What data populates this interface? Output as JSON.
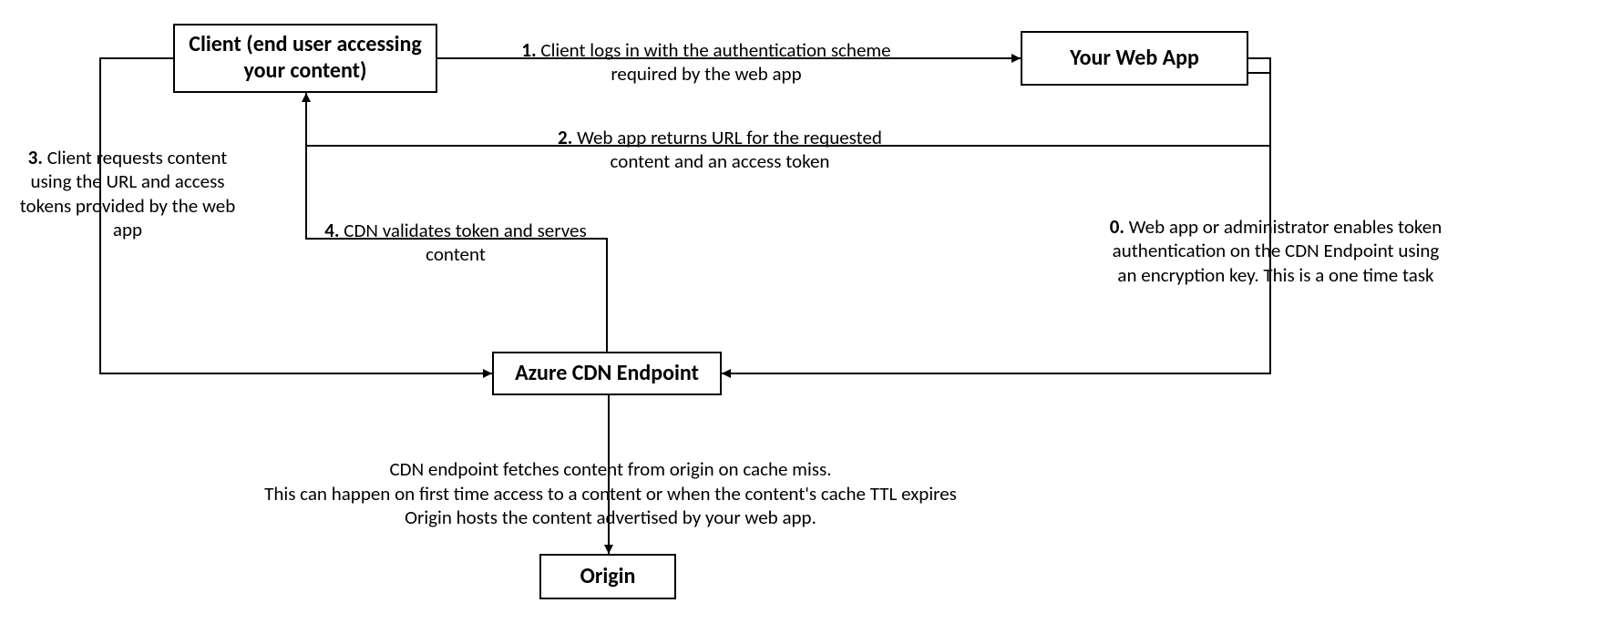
{
  "nodes": {
    "client": "Client (end user accessing your content)",
    "webapp": "Your Web App",
    "cdn": "Azure CDN Endpoint",
    "origin": "Origin"
  },
  "steps": {
    "s0": {
      "num": "0.",
      "text": "Web app or administrator enables token authentication on the CDN Endpoint using an encryption key. This is a one time task"
    },
    "s1": {
      "num": "1.",
      "text": "Client logs in with the authentication scheme required by the web app"
    },
    "s2": {
      "num": "2.",
      "text": "Web app returns URL for the requested content and an access token"
    },
    "s3": {
      "num": "3.",
      "text": "Client requests content using the URL and access tokens provided by the web app"
    },
    "s4": {
      "num": "4.",
      "text": "CDN validates token and serves content"
    },
    "origin_note": "CDN endpoint fetches content from origin on cache miss.\nThis can happen on first time access to a content or when the content's cache TTL expires\nOrigin hosts the content advertised by your web app."
  }
}
